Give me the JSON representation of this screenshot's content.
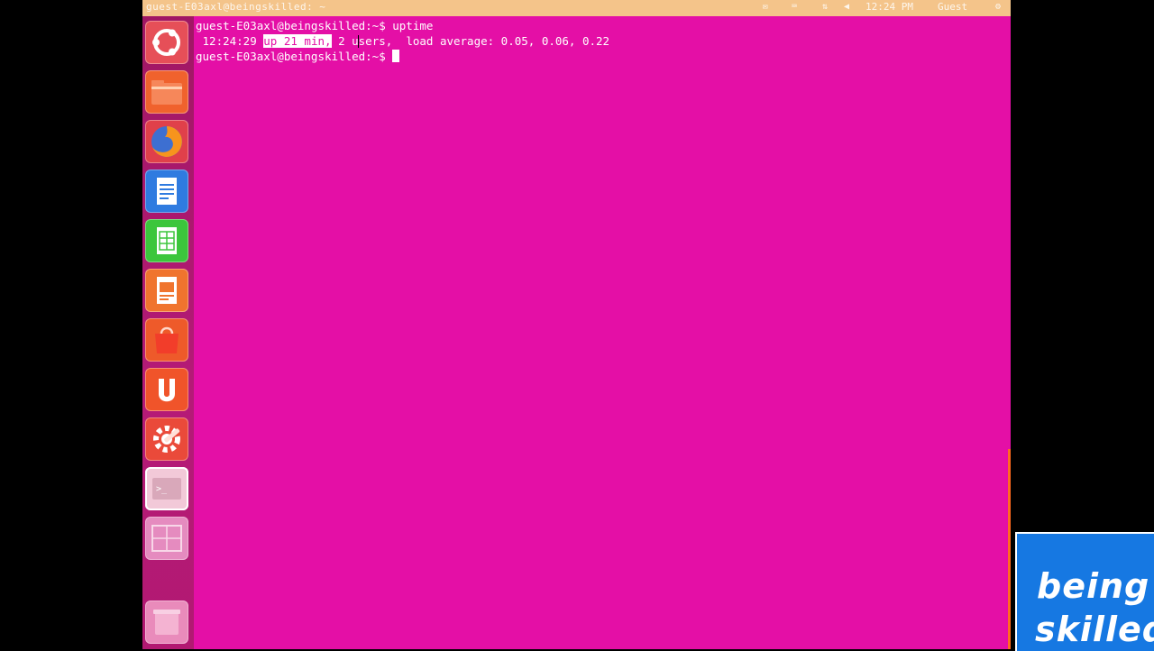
{
  "window": {
    "title": "guest-E03axl@beingskilled: ~",
    "tray": {
      "clock": "12:24 PM",
      "user": "Guest"
    }
  },
  "launcher": {
    "items": [
      {
        "name": "dash-home",
        "icon": "ubuntu-logo-icon"
      },
      {
        "name": "files",
        "icon": "folder-icon"
      },
      {
        "name": "firefox",
        "icon": "firefox-icon"
      },
      {
        "name": "libreoffice-writer",
        "icon": "writer-document-icon"
      },
      {
        "name": "libreoffice-calc",
        "icon": "calc-spreadsheet-icon"
      },
      {
        "name": "libreoffice-impress",
        "icon": "impress-presentation-icon"
      },
      {
        "name": "software-center",
        "icon": "shopping-bag-icon"
      },
      {
        "name": "ubuntu-one",
        "icon": "ubuntu-one-icon"
      },
      {
        "name": "system-settings",
        "icon": "gear-wrench-icon"
      },
      {
        "name": "terminal",
        "icon": "terminal-icon"
      },
      {
        "name": "workspace-switcher",
        "icon": "workspace-icon"
      },
      {
        "name": "trash",
        "icon": "trash-icon"
      }
    ]
  },
  "terminal": {
    "prompt": "guest-E03axl@beingskilled:~$",
    "command": "uptime",
    "output": {
      "time": " 12:24:29 ",
      "uptime": "up 21 min,",
      "space": " ",
      "rest": "2 users,  load average: 0.05, 0.06, 0.22"
    }
  },
  "watermark": {
    "line1": "being",
    "line2": "skilled"
  },
  "colors": {
    "terminal_bg": "#e40fa6",
    "launcher_bg": "#b51a77",
    "panel_bg": "#f4c48a",
    "logo_bg": "#1678e2"
  }
}
